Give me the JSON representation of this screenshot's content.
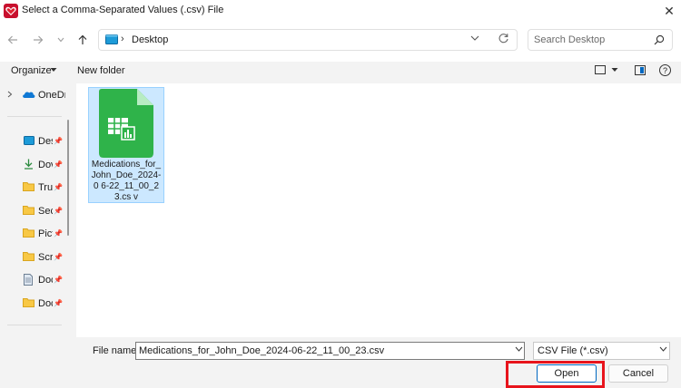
{
  "window": {
    "title": "Select a Comma-Separated Values (.csv) File",
    "close_glyph": "✕"
  },
  "address": {
    "location": "Desktop",
    "separator": "›"
  },
  "search": {
    "placeholder": "Search Desktop"
  },
  "toolbar": {
    "organize_label": "Organize",
    "new_folder_label": "New folder",
    "help_glyph": "?"
  },
  "nav": {
    "onedrive_label": "OneDr",
    "items": [
      {
        "label": "Des",
        "icon": "desktop-icon"
      },
      {
        "label": "Dov",
        "icon": "download-icon"
      },
      {
        "label": "Tru",
        "icon": "folder-icon"
      },
      {
        "label": "Sec",
        "icon": "folder-icon"
      },
      {
        "label": "Pict",
        "icon": "folder-icon"
      },
      {
        "label": "Scre",
        "icon": "folder-icon"
      },
      {
        "label": "Doc",
        "icon": "document-icon"
      },
      {
        "label": "Doc",
        "icon": "folder-icon"
      }
    ]
  },
  "files": [
    {
      "name": "Medications_for_John_Doe_2024-06-22_11_00_23.csv",
      "display_name": "Medications_for_ John_Doe_2024-0 6-22_11_00_23.cs v",
      "selected": true,
      "icon": "csv-spreadsheet-icon"
    }
  ],
  "footer": {
    "file_name_label": "File name:",
    "file_name_value": "Medications_for_John_Doe_2024-06-22_11_00_23.csv",
    "file_type_value": "CSV File (*.csv)",
    "open_label": "Open",
    "cancel_label": "Cancel"
  },
  "colors": {
    "accent": "#0067c0",
    "selection": "#cce8ff",
    "highlight_box": "#e8141c",
    "csv_icon": "#2fb34a"
  }
}
